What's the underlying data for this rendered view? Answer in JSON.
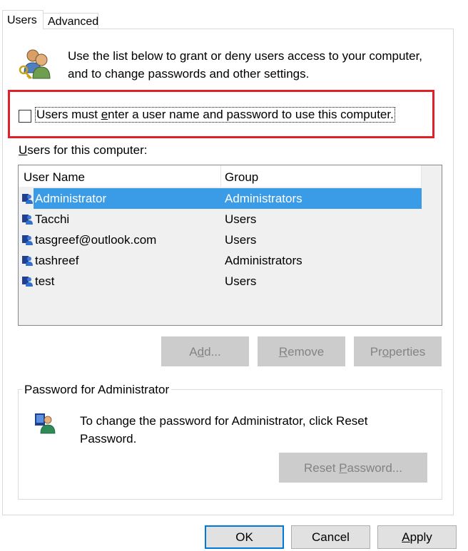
{
  "tabs": [
    {
      "label": "Users",
      "active": true
    },
    {
      "label": "Advanced",
      "active": false
    }
  ],
  "intro": {
    "icon": "users-keys-icon",
    "line1": "Use the list below to grant or deny users access to your computer,",
    "line2": "and to change passwords and other settings."
  },
  "require_login": {
    "checked": false,
    "label_before": "Users must ",
    "label_mnemonic": "e",
    "label_after": "nter a user name and password to use this computer.",
    "highlight_color": "#e0202a"
  },
  "users_list": {
    "caption_mnemonic": "U",
    "caption_rest": "sers for this computer:",
    "columns": [
      "User Name",
      "Group"
    ],
    "rows": [
      {
        "user": "Administrator",
        "group": "Administrators",
        "selected": true
      },
      {
        "user": "Tacchi",
        "group": "Users",
        "selected": false
      },
      {
        "user": "tasgreef@outlook.com",
        "group": "Users",
        "selected": false
      },
      {
        "user": "tashreef",
        "group": "Administrators",
        "selected": false
      },
      {
        "user": "test",
        "group": "Users",
        "selected": false
      }
    ],
    "row_icon": "user-icon",
    "selection_color": "#3a9be6"
  },
  "list_buttons": {
    "add": {
      "pre": "A",
      "mnemonic": "d",
      "post": "d...",
      "enabled": false
    },
    "remove": {
      "pre": "",
      "mnemonic": "R",
      "post": "emove",
      "enabled": false
    },
    "properties": {
      "pre": "Pr",
      "mnemonic": "o",
      "post": "perties",
      "enabled": false
    }
  },
  "password_group": {
    "legend": "Password for Administrator",
    "icon": "user-password-icon",
    "text_line1": "To change the password for Administrator, click Reset",
    "text_line2": "Password.",
    "reset_button": {
      "pre": "Reset ",
      "mnemonic": "P",
      "post": "assword...",
      "enabled": false
    }
  },
  "dialog_buttons": {
    "ok": "OK",
    "cancel": "Cancel",
    "apply": {
      "mnemonic": "A",
      "post": "pply"
    }
  }
}
